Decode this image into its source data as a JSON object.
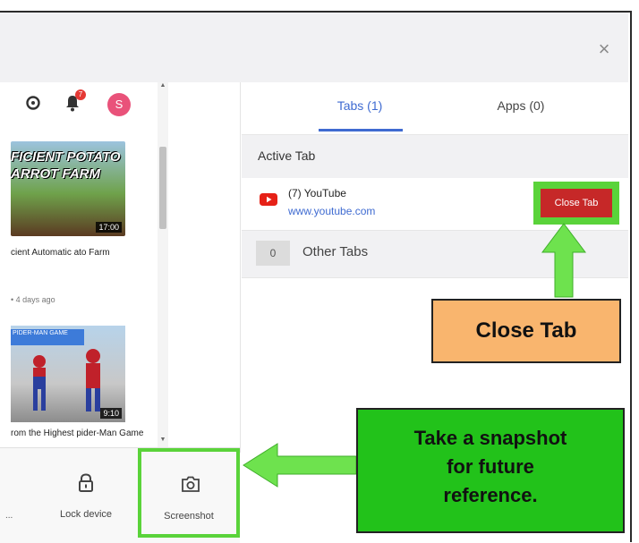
{
  "header": {
    "close_symbol": "×"
  },
  "left_pane": {
    "notification_badge": "7",
    "avatar_letter": "S",
    "video1": {
      "thumb_text": "FICIENT POTATO ARROT FARM",
      "duration": "17:00",
      "title": "cient Automatic ato Farm",
      "meta": "• 4 days ago"
    },
    "video2": {
      "thumb_banner": "PIDER-MAN GAME",
      "duration": "9:10",
      "title": "rom the Highest pider-Man Game"
    }
  },
  "bottom_bar": {
    "prev_label": "...",
    "lock_label": "Lock device",
    "screenshot_label": "Screenshot"
  },
  "tabs_panel": {
    "tabs_label": "Tabs (1)",
    "apps_label": "Apps (0)",
    "active_header": "Active Tab",
    "active_tab": {
      "title": "(7) YouTube",
      "url": "www.youtube.com",
      "close_button": "Close Tab"
    },
    "other_count": "0",
    "other_label": "Other Tabs"
  },
  "callouts": {
    "close_tab": "Close Tab",
    "snapshot_line1": "Take a snapshot",
    "snapshot_line2": "for future",
    "snapshot_line3": "reference."
  },
  "colors": {
    "accent_blue": "#3f6bd1",
    "close_red": "#c62828",
    "highlight_green": "#5ad33a",
    "callout_orange": "#f9b56e",
    "callout_green": "#22c21a"
  },
  "icons": [
    "close-icon",
    "chat-icon",
    "bell-icon",
    "youtube-icon",
    "lock-icon",
    "camera-icon"
  ]
}
